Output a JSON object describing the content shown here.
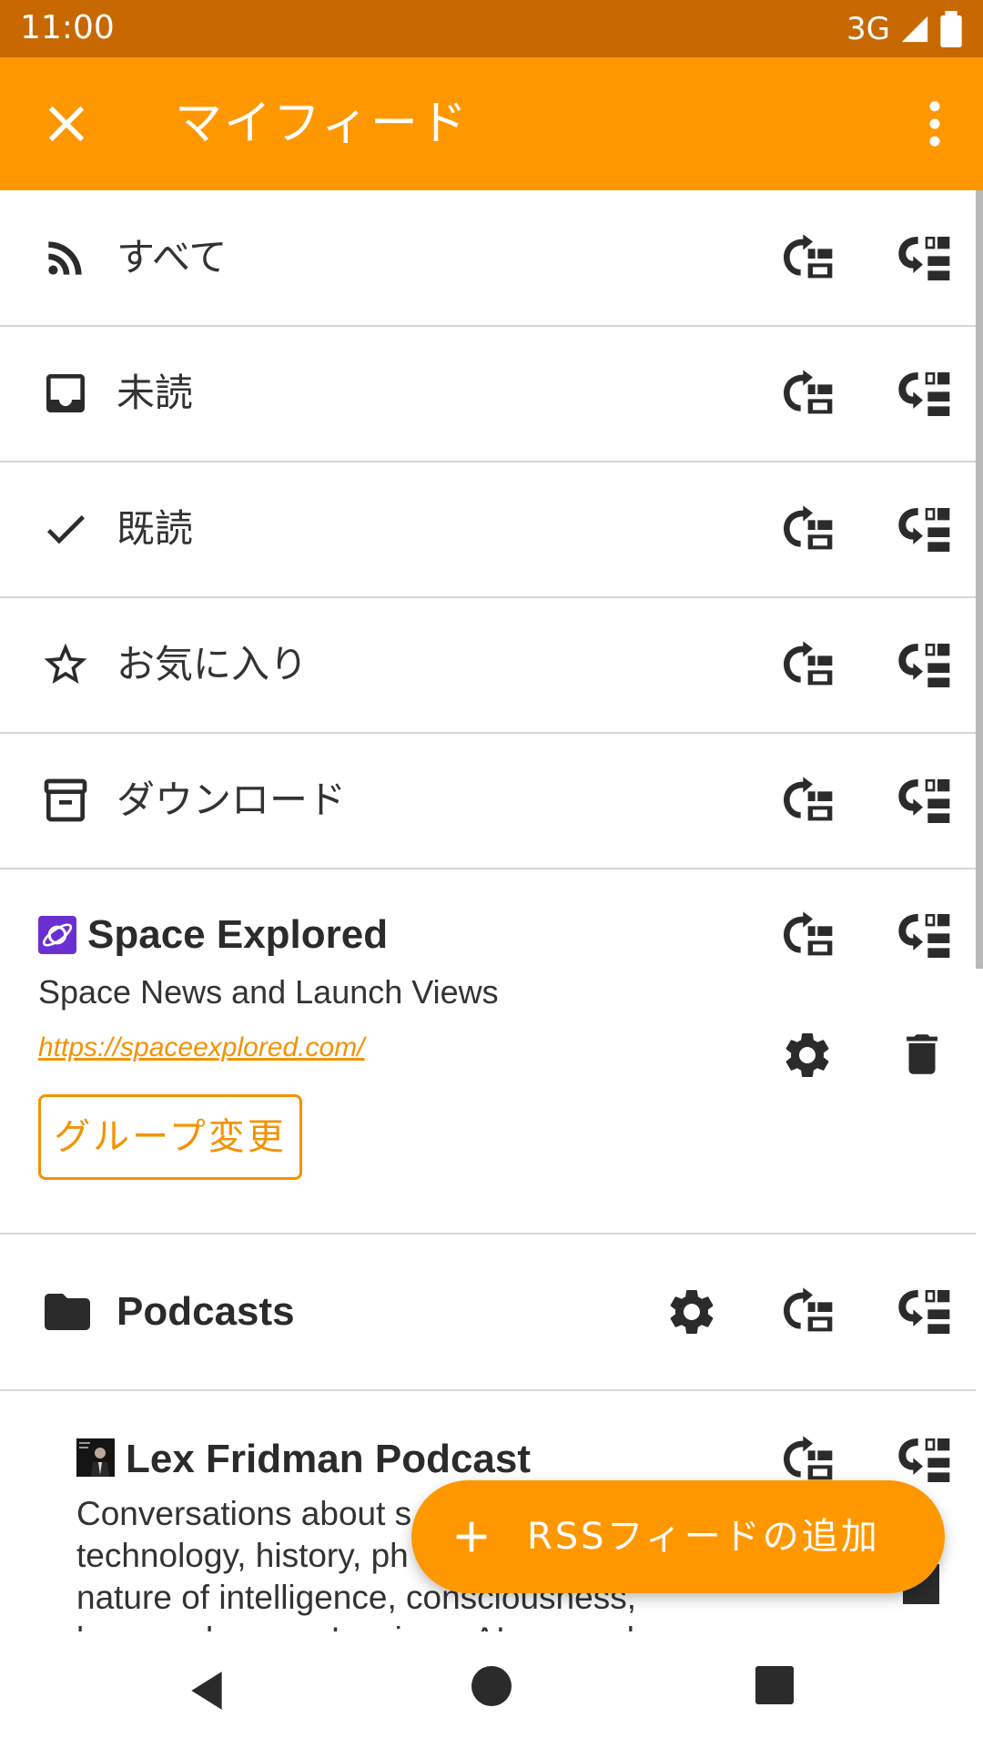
{
  "status_bar": {
    "time": "11:00",
    "network": "3G"
  },
  "app_bar": {
    "title": "マイフィード",
    "close_icon": "close-icon",
    "menu_icon": "more-vert-icon"
  },
  "rows": [
    {
      "label": "すべて",
      "icon": "rss-icon"
    },
    {
      "label": "未読",
      "icon": "inbox-icon"
    },
    {
      "label": "既読",
      "icon": "check-icon"
    },
    {
      "label": "お気に入り",
      "icon": "star-icon"
    },
    {
      "label": "ダウンロード",
      "icon": "archive-icon"
    }
  ],
  "feed": {
    "title": "Space Explored",
    "description": "Space News and Launch Views",
    "url": "https://spaceexplored.com/",
    "group_button": "グループ変更"
  },
  "folder": {
    "label": "Podcasts"
  },
  "sub_feed": {
    "title": "Lex Fridman Podcast",
    "description_lines": [
      "Conversations about s",
      "technology, history, ph",
      "nature of intelligence, consciousness,",
      "love, and power. Lex is an AI researcher"
    ]
  },
  "fab": {
    "label": "RSSフィードの追加"
  },
  "colors": {
    "accent": "#ff9800",
    "status_bar": "#c76800",
    "link": "#f39200"
  }
}
